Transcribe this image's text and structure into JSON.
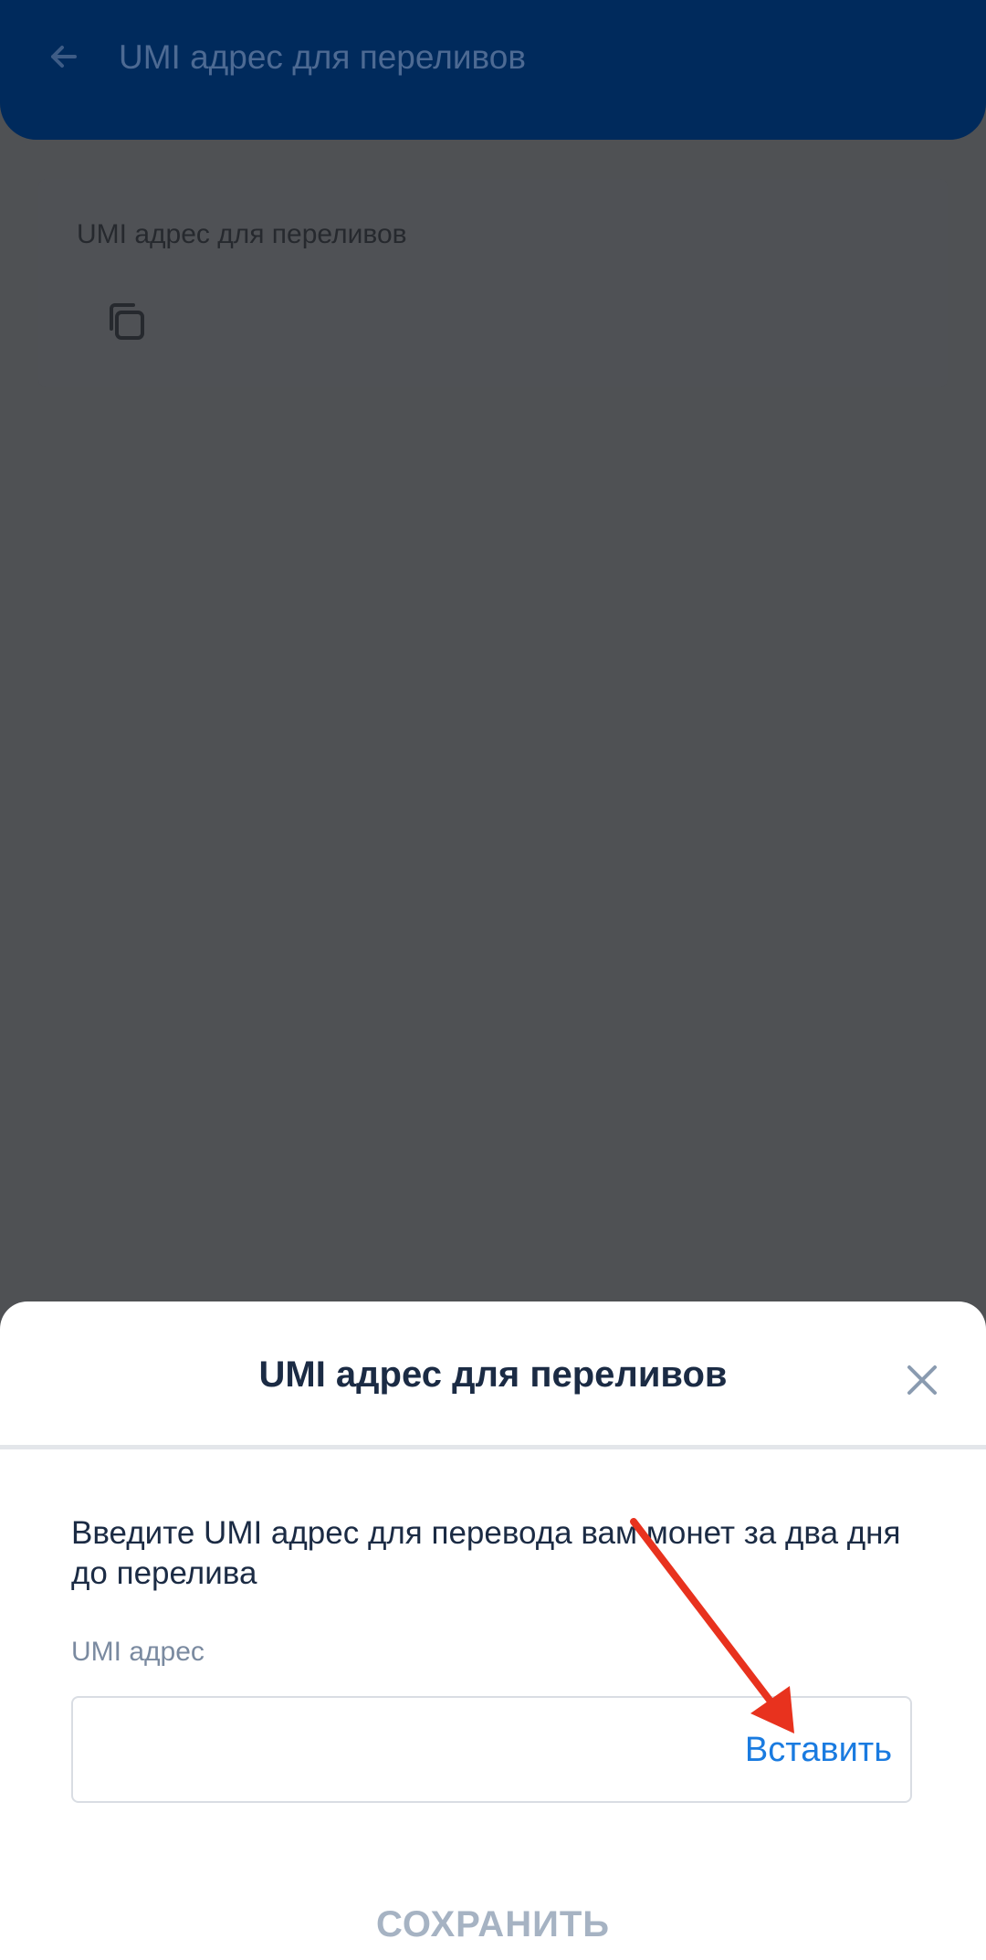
{
  "header": {
    "title": "UMI адрес для переливов",
    "back_icon": "arrow-left-icon"
  },
  "address_card": {
    "label": "UMI адрес для переливов",
    "copy_icon": "copy-icon"
  },
  "sheet": {
    "title": "UMI адрес для переливов",
    "close_icon": "close-icon",
    "description": "Введите UMI адрес для перевода вам монет за два дня до перелива",
    "field_label": "UMI адрес",
    "input_value": "",
    "paste_label": "Вставить",
    "save_label": "СОХРАНИТЬ"
  },
  "colors": {
    "header_blue": "#0a4fb8",
    "link_blue": "#1a7be0",
    "annotation_red": "#e8321e",
    "disabled_grey": "#a6b3c3"
  }
}
